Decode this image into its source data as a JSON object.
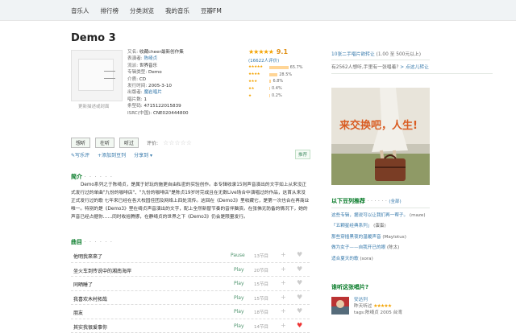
{
  "nav": {
    "items": [
      "音乐人",
      "排行榜",
      "分类浏览",
      "我的音乐",
      "豆瓣FM"
    ]
  },
  "album": {
    "title": "Demo 3",
    "cover_caption": "更新描述或封面",
    "info": {
      "alias_label": "又名:",
      "alias": "收藏cheer最新创作集",
      "performer_label": "表演者:",
      "performer": "陈绮贞",
      "genre_label": "流派:",
      "genre": "世界音乐",
      "type_label": "专辑类型:",
      "type": "Demo",
      "media_label": "介质:",
      "media": "CD",
      "date_label": "发行时间:",
      "date": "2005-3-10",
      "publisher_label": "出版者:",
      "publisher": "魔岩唱片",
      "discs_label": "唱片数:",
      "discs": "1",
      "barcode_label": "条型码:",
      "barcode": "4715122015839",
      "isrc_label": "ISRC(中国):",
      "isrc": "CNE020444800"
    }
  },
  "rating": {
    "score": "9.1",
    "count_text": "(16622人评价)",
    "bars": [
      {
        "stars": "★★★★★",
        "percent": 65.7,
        "label": "65.7%"
      },
      {
        "stars": "★★★★",
        "percent": 28.5,
        "label": "28.5%"
      },
      {
        "stars": "★★★",
        "percent": 6.8,
        "label": "6.8%"
      },
      {
        "stars": "★★",
        "percent": 0.4,
        "label": "0.4%"
      },
      {
        "stars": "★",
        "percent": 0.2,
        "label": "0.2%"
      }
    ]
  },
  "actions": {
    "want": "想听",
    "listening": "在听",
    "listened": "听过",
    "evaluate_label": "评价:",
    "review": "写乐评",
    "add_list": "添加到豆列",
    "share": "分享到",
    "recommend": "推荐"
  },
  "intro": {
    "heading": "简介",
    "dots": "· · · · · ·",
    "text": "Demo系列之于陈绮贞，是属于好玩的施更自由私密的实验创作。本专辑收录15则声音演出的文字如上从来没正式发行过的单曲\"九份的咖啡店\"、\"九份的咖啡店\"是陈贞19岁时完成且在无数Live场合中演唱过的作品，这首从来没正式发行过的歌 七年来已经在各大校园佳团及网络上四处流传。这回在《Demo3》里收藏它，是第一次也合在再商业唯一。特别的是《Demo3》里在绮贞声音演出的文字，配上全然新替节奏的音伴脑资。在张佛无防备的情况下，她的声音已经占据你……同时收拾腾挪，在静绮贞的世界之下《Demo3》仍会是限量发行。"
  },
  "tracks": {
    "heading": "曲目",
    "dots": "· · · · · ·",
    "list": [
      {
        "name": "他明我來來了",
        "play": "Pause",
        "votes": "13节目",
        "liked": false
      },
      {
        "name": "坐火车到传说中的湘南海岸",
        "play": "Play",
        "votes": "20节目",
        "liked": false
      },
      {
        "name": "同晒睡了",
        "play": "Play",
        "votes": "15节目",
        "liked": false
      },
      {
        "name": "我喜欢木村拓哉",
        "play": "Play",
        "votes": "15节目",
        "liked": false
      },
      {
        "name": "朋友",
        "play": "Play",
        "votes": "18节目",
        "liked": false
      },
      {
        "name": "其实我很爱事你",
        "play": "Play",
        "votes": "14节目",
        "liked": true
      }
    ]
  },
  "sidebar": {
    "trade_link": "10张二手唱片欲转让",
    "trade_price": "(1.00 至 500元以上)",
    "sell_text": "有2562人想听,手里有一张唱着?",
    "sell_link": "> 点这儿转让",
    "ad_text": "来交换吧，人生!",
    "lists_heading": "以下豆列推荐",
    "lists_dots": "· · · · · ·",
    "lists_all": "(全部)",
    "lists": [
      {
        "title": "这些专辑，据说可以让我们再一帮子。",
        "author": "(maze)"
      },
      {
        "title": "「五颗星经典系列」",
        "author": "(蛋蛋)"
      },
      {
        "title": "那些穿插黑夜的温暖声音",
        "author": "(Maylotus)"
      },
      {
        "title": "做为女子——自我开已的眼",
        "author": "(陈太)"
      },
      {
        "title": "适合夏天的歌",
        "author": "(sora)"
      }
    ],
    "listeners_heading": "谁听这张唱片?",
    "listener": {
      "name": "安达列",
      "time": "昨天听过",
      "tags": "tags:陈绮贞 2005 台湾"
    }
  },
  "colors": {
    "accent_green": "#007722",
    "link_blue": "#3377aa",
    "star_orange": "#f4a300",
    "heart_red": "#ee3333"
  }
}
